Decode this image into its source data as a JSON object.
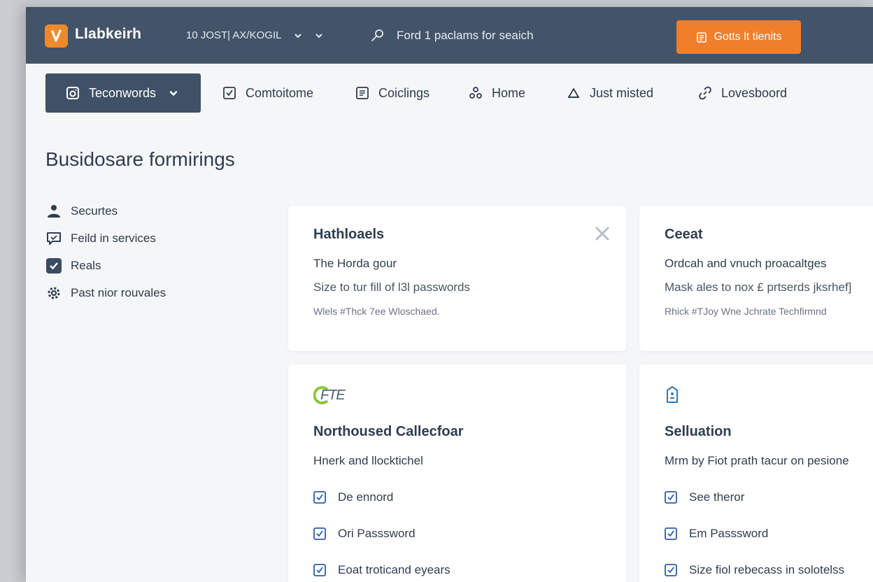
{
  "app": {
    "name": "Llabkeirh"
  },
  "topbar": {
    "workspace_label": "10 JOST| AX/KOGIL",
    "search_placeholder": "Ford 1 paclams for seaich",
    "cta_label": "Gotts lt tienits"
  },
  "nav": {
    "active": {
      "label": "Teconwords"
    },
    "items": [
      {
        "label": "Comtoitome"
      },
      {
        "label": "Coiclings"
      },
      {
        "label": "Home"
      },
      {
        "label": "Just misted"
      },
      {
        "label": "Lovesboord"
      }
    ]
  },
  "page": {
    "title": "Busidosare formirings"
  },
  "sidebar": {
    "items": [
      {
        "label": "Securtes"
      },
      {
        "label": "Feild in services"
      },
      {
        "label": "Reals"
      },
      {
        "label": "Past nior rouvales"
      }
    ]
  },
  "cards": [
    {
      "title": "Hathloaels",
      "subtitle": "The Horda gour",
      "description": "Size to tur fill of l3l passwords",
      "meta": "Wlels #Thck 7ee Wloschaed."
    },
    {
      "title": "Ceeat",
      "subtitle": "Ordcah and vnuch proacaltges",
      "description": "Mask ales to nox £ prtserds jksrhef]",
      "meta": "Rhick #TJoy Wne Jchrate Techfirmnd"
    },
    {
      "icon_text": "FTE",
      "title": "Northoused Callecfoar",
      "subtitle": "Hnerk and llocktichel",
      "checks": [
        "De ennord",
        "Ori Passsword",
        "Eoat troticand eyears"
      ]
    },
    {
      "title": "Selluation",
      "subtitle": "Mrm by Fiot prath tacur on pesione",
      "checks": [
        "See theror",
        "Em Passsword",
        "Size fiol rebecass in solotelss"
      ]
    }
  ],
  "colors": {
    "topbar": "#435468",
    "accent": "#ef7f2b",
    "nav_active": "#3f5166",
    "check_blue": "#2b5ea8"
  }
}
